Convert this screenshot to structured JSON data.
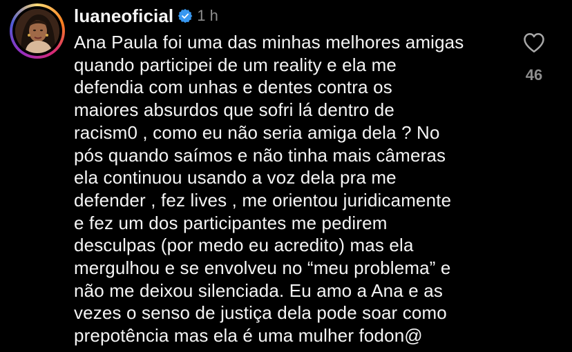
{
  "comment": {
    "username": "luaneoficial",
    "verified": true,
    "time": "1 h",
    "lines": [
      "Ana Paula foi uma das minhas melhores amigas",
      "quando participei de um reality e ela me",
      "defendia com unhas e dentes contra os",
      "maiores absurdos que sofri lá dentro de",
      "racism0 , como eu não seria amiga dela ? No",
      "pós quando saímos e não tinha mais câmeras",
      "ela continuou usando a voz dela pra me",
      "defender , fez lives , me orientou juridicamente",
      "e fez um dos participantes me pedirem",
      "desculpas (por medo eu acredito) mas ela",
      "mergulhou e se envolveu no “meu problema” e",
      "não me deixou silenciada. Eu amo  a Ana e as",
      "vezes o senso de justiça dela pode soar como",
      "prepotência mas ela é uma mulher fodon@"
    ],
    "like_count": "46",
    "icons": {
      "avatar": "avatar",
      "verified": "verified-badge-icon",
      "like": "heart-icon"
    },
    "colors": {
      "background": "#000000",
      "text": "#f5f5f5",
      "muted": "#8e8e8e",
      "verified": "#3897f0"
    }
  }
}
